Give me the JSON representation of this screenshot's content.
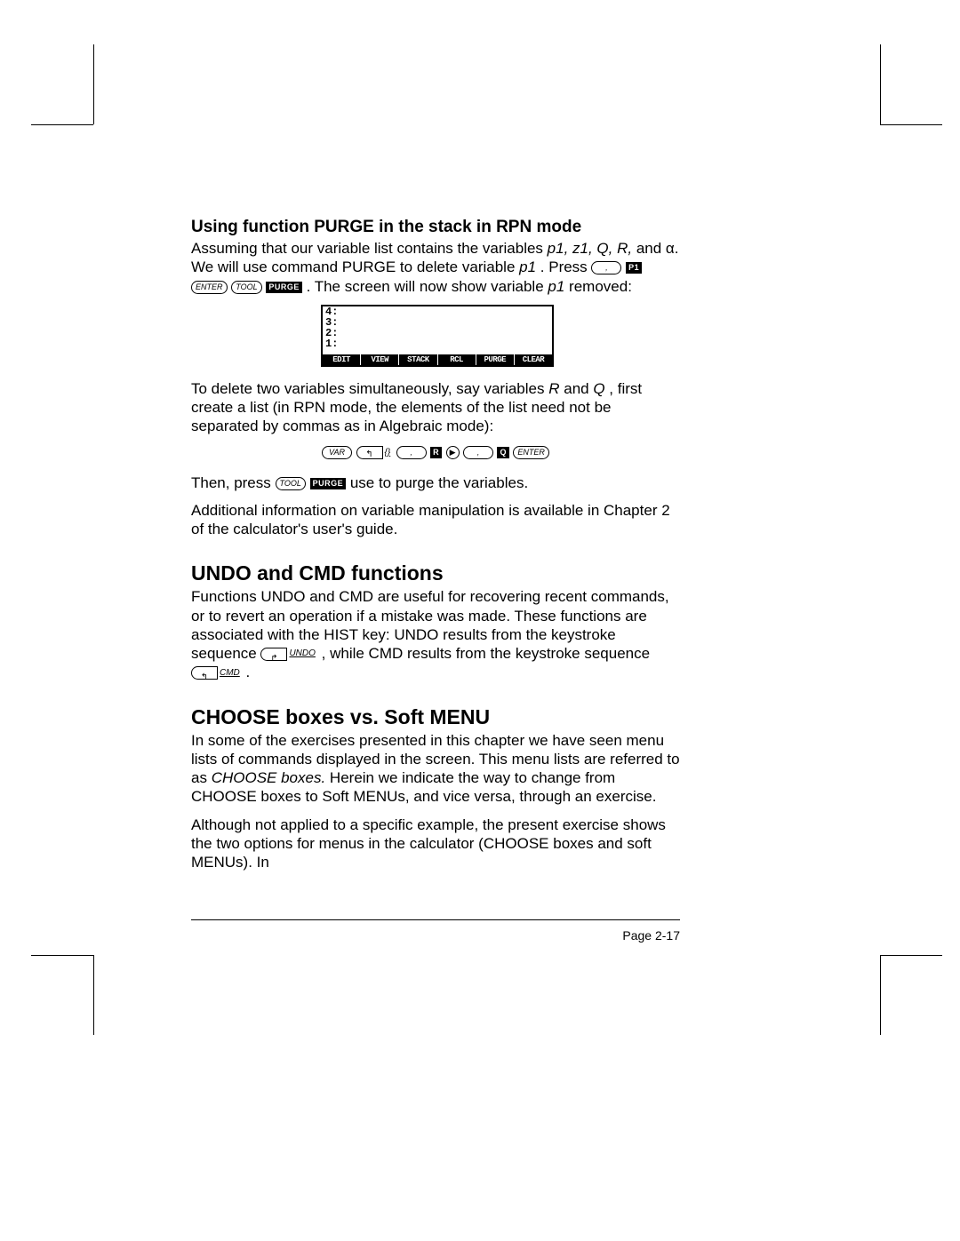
{
  "section1": {
    "heading": "Using function PURGE in the stack in RPN mode",
    "p1a": "Assuming that our variable list contains the variables ",
    "p1_vars": "p1, z1, Q, R,",
    "p1b": " and α. We will use command PURGE to delete variable ",
    "p1_var2": "p1",
    "p1c": ".   Press ",
    "p1d": ".   The screen will now show variable ",
    "p1e": " removed:"
  },
  "calc": {
    "lines": [
      "4:",
      "3:",
      "2:",
      "1:"
    ],
    "menu": [
      "EDIT",
      "VIEW",
      "STACK",
      "RCL",
      "PURGE",
      "CLEAR"
    ]
  },
  "section1b": {
    "p2a": "To delete two variables simultaneously, say variables ",
    "p2_r": "R",
    "p2_and": " and ",
    "p2_q": "Q",
    "p2b": ", first create a list (in RPN mode, the elements of the list need not be separated by commas as in Algebraic mode):",
    "p3a": "Then, press ",
    "p3b": " use to purge the variables.",
    "p4": "Additional information on variable manipulation is available in Chapter 2 of the calculator's user's guide."
  },
  "keys": {
    "enter": "ENTER",
    "tool": "TOOL",
    "purge": "PURGE",
    "p1": "P1",
    "var": "VAR",
    "brace": "{}",
    "r": "R",
    "q": "Q",
    "undo": "UNDO",
    "cmd": "CMD",
    "tick": "‚",
    "arrow": "▶"
  },
  "section2": {
    "heading": "UNDO and CMD functions",
    "p1a": "Functions UNDO and CMD are useful for recovering recent commands, or to revert an operation if a mistake was made.  These functions are associated with the HIST key: UNDO results from the keystroke sequence ",
    "p1b": " , while CMD results from the keystroke sequence ",
    "p1c": " ."
  },
  "section3": {
    "heading": "CHOOSE boxes vs. Soft MENU",
    "p1a": "In some of the exercises presented in this chapter we have seen menu lists of commands displayed in the screen.  This menu lists are referred to as ",
    "p1_em": "CHOOSE boxes.",
    "p1b": "  Herein we indicate the way to change from CHOOSE boxes to Soft MENUs, and vice versa, through an exercise.",
    "p2": "Although not applied to a specific example, the present exercise shows the two options for menus in the calculator (CHOOSE boxes and soft MENUs).  In"
  },
  "footer": {
    "page": "Page 2-17"
  }
}
